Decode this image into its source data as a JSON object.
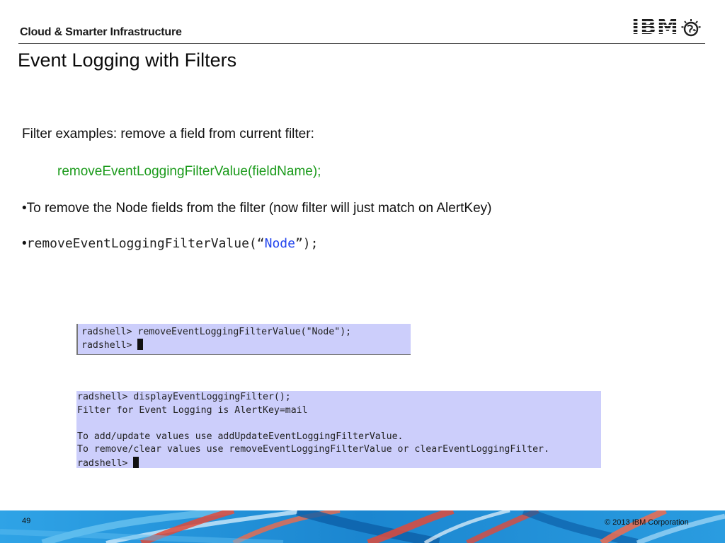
{
  "header": {
    "brand": "Cloud & Smarter Infrastructure",
    "logo_text": "IBM",
    "logo_icon": "globe-icon"
  },
  "slide": {
    "title": "Event Logging with Filters",
    "line1": "Filter examples: remove a field from current filter:",
    "line2": "removeEventLoggingFilterValue(fieldName);",
    "line3": "•To remove the Node fields from the filter (now filter will just match on AlertKey)",
    "line4": {
      "bullet": "•",
      "prefix": "removeEventLoggingFilterValue(“",
      "arg": "Node",
      "suffix": "”);"
    }
  },
  "terminal1": {
    "lines": [
      "radshell> removeEventLoggingFilterValue(\"Node\");",
      "radshell> "
    ]
  },
  "terminal2": {
    "lines": [
      "radshell> displayEventLoggingFilter();",
      "Filter for Event Logging is AlertKey=mail",
      "",
      "To add/update values use addUpdateEventLoggingFilterValue.",
      "To remove/clear values use removeEventLoggingFilterValue or clearEventLoggingFilter.",
      "radshell> "
    ]
  },
  "footer": {
    "page_number": "49",
    "copyright": "© 2013 IBM Corporation"
  },
  "colors": {
    "code_green": "#1a9a1a",
    "code_blue": "#2244ee",
    "terminal_bg": "#cccefb",
    "footer_blue": "#1e8fd6"
  }
}
